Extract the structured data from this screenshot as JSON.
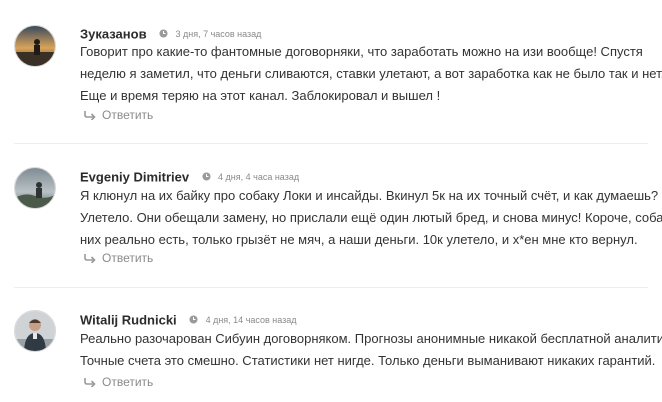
{
  "comments": [
    {
      "author": "Зуказанов",
      "time": "3 дня, 7 часов назад",
      "lines": [
        "Говорит про какие-то фантомные договорняки, что заработать можно на изи вообще! Спустя",
        "неделю я заметил, что деньги сливаются, ставки улетают, а вот заработка как не было так и нет.",
        "Еще и время теряю на этот канал. Заблокировал и вышел !"
      ],
      "reply_label": "Ответить"
    },
    {
      "author": "Evgeniy Dimitriev",
      "time": "4 дня, 4 часа назад",
      "lines": [
        "Я клюнул на их байку про собаку Локи и инсайды. Вкинул 5к на их точный счёт, и как думаешь?",
        "Улетело. Они обещали замену, но прислали ещё один лютый бред, и снова минус! Короче, собака у",
        "них реально есть, только грызёт не мяч, а наши деньги. 10к улетело, и х*ен мне кто вернул."
      ],
      "reply_label": "Ответить"
    },
    {
      "author": "Witalij Rudnicki",
      "time": "4 дня, 14 часов назад",
      "lines": [
        "Реально разочарован Сибуин договорняком. Прогнозы анонимные никакой бесплатной аналитики.",
        "Точные счета это смешно. Статистики нет нигде. Только деньги выманивают никаких гарантий."
      ],
      "reply_label": "Ответить"
    }
  ],
  "icons": {
    "clock": "clock-icon",
    "reply": "reply-arrow-icon"
  },
  "colors": {
    "author": "#2b2b2b",
    "text": "#333333",
    "meta": "#8a8a8a"
  }
}
